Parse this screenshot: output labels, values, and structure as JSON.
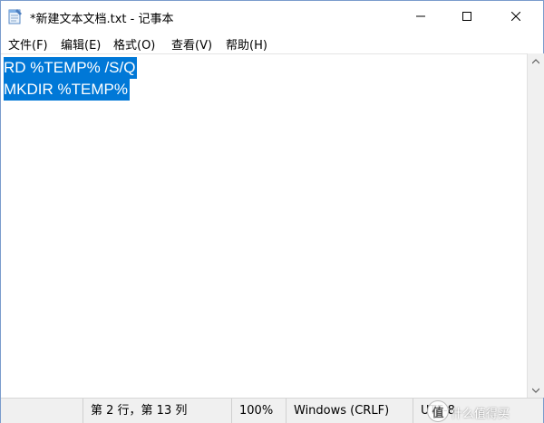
{
  "window": {
    "title": "*新建文本文档.txt - 记事本"
  },
  "menu": {
    "file": "文件(F)",
    "edit": "编辑(E)",
    "format": "格式(O)",
    "view": "查看(V)",
    "help": "帮助(H)"
  },
  "editor": {
    "lines": [
      "RD %TEMP% /S/Q",
      "MKDIR %TEMP%"
    ]
  },
  "status": {
    "position": "第 2 行，第 13 列",
    "zoom": "100%",
    "line_ending": "Windows (CRLF)",
    "encoding": "UTF-8"
  },
  "watermark": {
    "logo": "值",
    "text": "什么值得买"
  },
  "colors": {
    "selection": "#0078d7",
    "statusbar_bg": "#f0f0f0"
  }
}
